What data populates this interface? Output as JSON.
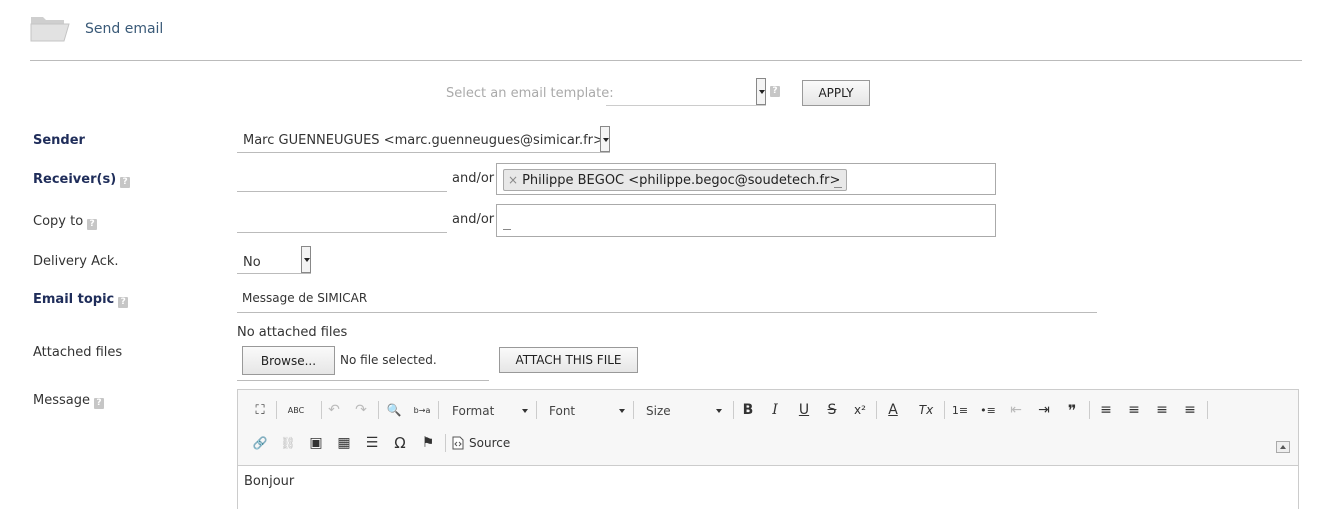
{
  "header": {
    "title": "Send email"
  },
  "template": {
    "label": "Select an email template:",
    "value": "",
    "help": "?",
    "apply_label": "APPLY"
  },
  "form": {
    "sender": {
      "label": "Sender",
      "value": "Marc GUENNEUGUES <marc.guenneugues@simicar.fr>"
    },
    "receivers": {
      "label": "Receiver(s)",
      "help": "?",
      "input_value": "",
      "andor": "and/or",
      "tags": [
        "Philippe BEGOC <philippe.begoc@soudetech.fr>"
      ],
      "tag_remove": "×"
    },
    "copy_to": {
      "label": "Copy to",
      "help": "?",
      "input_value": "",
      "andor": "and/or"
    },
    "delivery_ack": {
      "label": "Delivery Ack.",
      "value": "No"
    },
    "topic": {
      "label": "Email topic",
      "help": "?",
      "value": "Message de SIMICAR"
    },
    "attachments": {
      "label": "Attached files",
      "status": "No attached files",
      "browse_label": "Browse...",
      "file_status": "No file selected.",
      "attach_label": "ATTACH THIS FILE"
    },
    "message": {
      "label": "Message",
      "help": "?"
    }
  },
  "editor": {
    "format_label": "Format",
    "font_label": "Font",
    "size_label": "Size",
    "source_label": "Source",
    "body": "Bonjour",
    "icons": {
      "maximize": "⛶",
      "spellcheck": "ABC",
      "undo": "↶",
      "redo": "↷",
      "find": "🔍",
      "replace": "b→a",
      "bold": "B",
      "italic": "I",
      "underline": "U",
      "strike": "S",
      "superscript": "x²",
      "text_color": "A",
      "remove_format": "Tx",
      "numbered_list": "1≡",
      "bullet_list": "•≡",
      "outdent": "⇤",
      "indent": "⇥",
      "blockquote": "❞",
      "align_left": "≡",
      "align_center": "≡",
      "align_right": "≡",
      "justify": "≡",
      "link": "🔗",
      "unlink": "⛓",
      "image": "▣",
      "table": "▦",
      "horizontal_rule": "☰",
      "special_char": "Ω",
      "anchor": "⚑"
    }
  }
}
